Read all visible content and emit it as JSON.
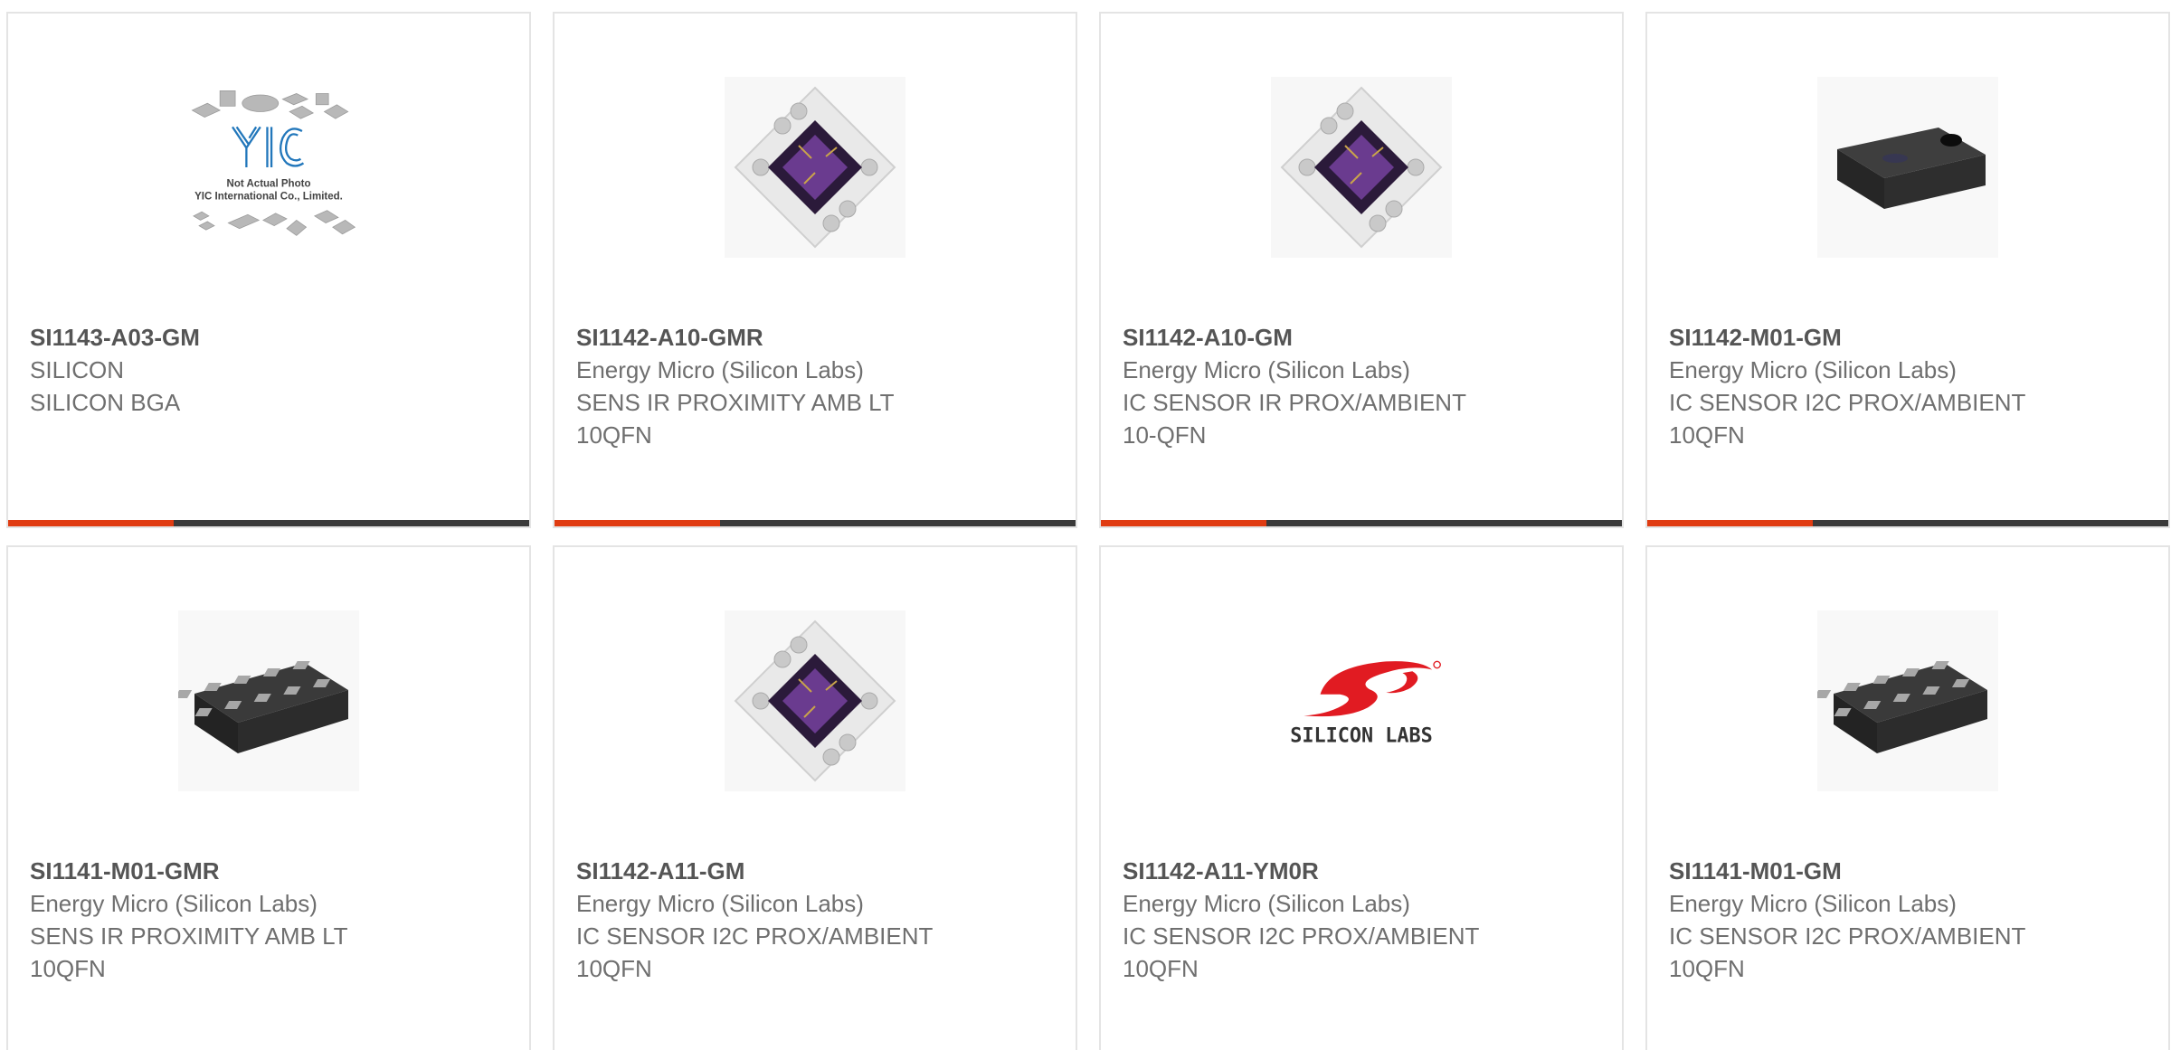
{
  "colors": {
    "accent": "#e03c12",
    "bar": "#3a3a3a",
    "part_text": "#555555",
    "body_text": "#6f6f6f"
  },
  "products": [
    {
      "part": "SI1143-A03-GM",
      "manufacturer": "SILICON",
      "desc": "SILICON BGA",
      "package": "",
      "image": "placeholder-yic",
      "image_text": [
        "Not Actual Photo",
        "YIC International Co., Limited."
      ]
    },
    {
      "part": "SI1142-A10-GMR",
      "manufacturer": "Energy Micro (Silicon Labs)",
      "desc": "SENS IR PROXIMITY AMB LT",
      "package": "10QFN",
      "image": "chip-die-photo"
    },
    {
      "part": "SI1142-A10-GM",
      "manufacturer": "Energy Micro (Silicon Labs)",
      "desc": "IC SENSOR IR PROX/AMBIENT",
      "package": "10-QFN",
      "image": "chip-die-photo"
    },
    {
      "part": "SI1142-M01-GM",
      "manufacturer": "Energy Micro (Silicon Labs)",
      "desc": "IC SENSOR I2C PROX/AMBIENT",
      "package": "10QFN",
      "image": "black-module-photo"
    },
    {
      "part": "SI1141-M01-GMR",
      "manufacturer": "Energy Micro (Silicon Labs)",
      "desc": "SENS IR PROXIMITY AMB LT",
      "package": "10QFN",
      "image": "qfn-package-photo"
    },
    {
      "part": "SI1142-A11-GM",
      "manufacturer": "Energy Micro (Silicon Labs)",
      "desc": "IC SENSOR I2C PROX/AMBIENT",
      "package": "10QFN",
      "image": "chip-die-photo"
    },
    {
      "part": "SI1142-A11-YM0R",
      "manufacturer": "Energy Micro (Silicon Labs)",
      "desc": "IC SENSOR I2C PROX/AMBIENT",
      "package": "10QFN",
      "image": "silicon-labs-logo",
      "image_text": [
        "SILICON LABS"
      ]
    },
    {
      "part": "SI1141-M01-GM",
      "manufacturer": "Energy Micro (Silicon Labs)",
      "desc": "IC SENSOR I2C PROX/AMBIENT",
      "package": "10QFN",
      "image": "qfn-package-photo"
    }
  ]
}
